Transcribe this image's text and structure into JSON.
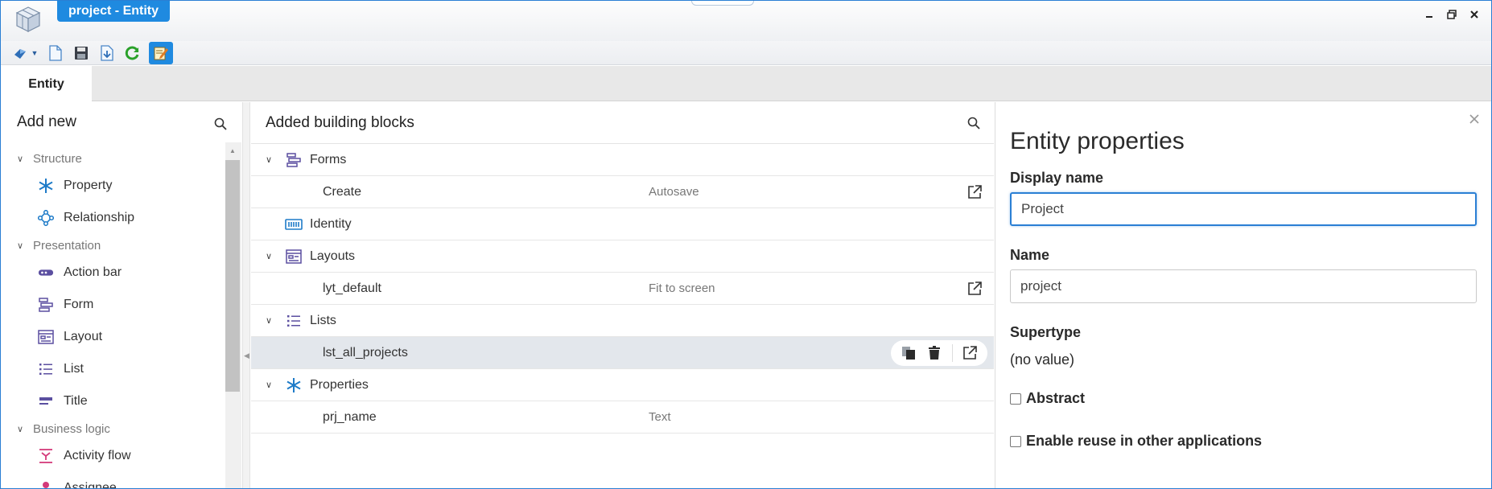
{
  "window": {
    "title": "project - Entity"
  },
  "tabs": [
    {
      "label": "Entity"
    }
  ],
  "left_panel": {
    "title": "Add new",
    "groups": [
      {
        "label": "Structure",
        "items": [
          {
            "label": "Property",
            "icon": "asterisk-icon"
          },
          {
            "label": "Relationship",
            "icon": "relationship-icon"
          }
        ]
      },
      {
        "label": "Presentation",
        "items": [
          {
            "label": "Action bar",
            "icon": "action-bar-icon"
          },
          {
            "label": "Form",
            "icon": "form-icon"
          },
          {
            "label": "Layout",
            "icon": "layout-icon"
          },
          {
            "label": "List",
            "icon": "list-icon"
          },
          {
            "label": "Title",
            "icon": "title-icon"
          }
        ]
      },
      {
        "label": "Business logic",
        "items": [
          {
            "label": "Activity flow",
            "icon": "activity-flow-icon"
          },
          {
            "label": "Assignee",
            "icon": "assignee-icon"
          }
        ]
      }
    ]
  },
  "middle_panel": {
    "title": "Added building blocks",
    "rows": [
      {
        "label": "Forms",
        "kind": "group"
      },
      {
        "label": "Create",
        "desc": "Autosave",
        "kind": "item"
      },
      {
        "label": "Identity",
        "kind": "single"
      },
      {
        "label": "Layouts",
        "kind": "group"
      },
      {
        "label": "lyt_default",
        "desc": "Fit to screen",
        "kind": "item"
      },
      {
        "label": "Lists",
        "kind": "group"
      },
      {
        "label": "lst_all_projects",
        "desc": "",
        "kind": "item-selected"
      },
      {
        "label": "Properties",
        "kind": "group"
      },
      {
        "label": "prj_name",
        "desc": "Text",
        "kind": "item"
      }
    ]
  },
  "right_panel": {
    "title": "Entity properties",
    "display_name_label": "Display name",
    "display_name_value": "Project",
    "name_label": "Name",
    "name_value": "project",
    "supertype_label": "Supertype",
    "supertype_value": "(no value)",
    "abstract_label": "Abstract",
    "reuse_label": "Enable reuse in other applications"
  },
  "colors": {
    "accent": "#1f8ae0",
    "icon_purple": "#5b4fa0",
    "icon_blue": "#1e7bc8",
    "icon_pink": "#d43a7a"
  }
}
